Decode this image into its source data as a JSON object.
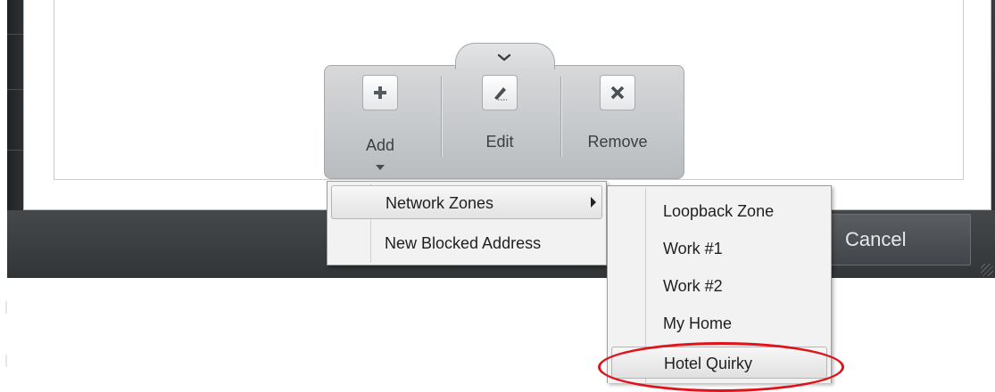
{
  "dialog": {
    "cancel_label": "Cancel"
  },
  "toolbar": {
    "add_label": "Add",
    "edit_label": "Edit",
    "remove_label": "Remove"
  },
  "add_menu": {
    "items": [
      {
        "label": "Network Zones",
        "has_submenu": true,
        "highlighted": true
      },
      {
        "label": "New Blocked Address",
        "has_submenu": false,
        "highlighted": false
      }
    ]
  },
  "network_zones_submenu": {
    "items": [
      {
        "label": "Loopback Zone"
      },
      {
        "label": "Work #1"
      },
      {
        "label": "Work #2"
      },
      {
        "label": "My Home"
      },
      {
        "label": "Hotel Quirky",
        "highlighted": true
      }
    ]
  },
  "annotation": {
    "highlight_color": "#e0121a",
    "target": "Hotel Quirky"
  }
}
